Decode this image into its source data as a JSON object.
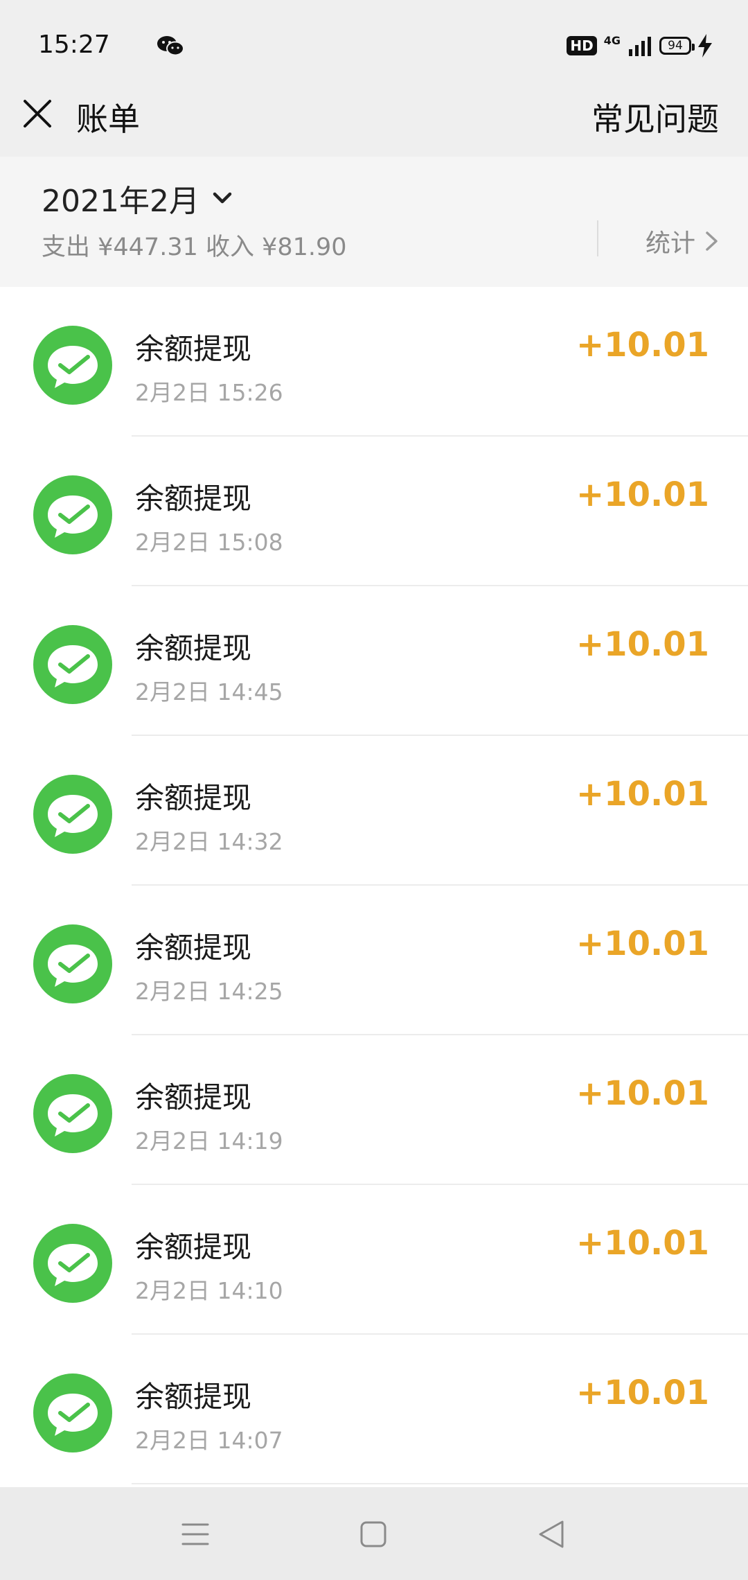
{
  "status_bar": {
    "time": "15:27",
    "notification_icon": "wechat-icon",
    "hd_badge": "HD",
    "network": "4G",
    "battery": "94"
  },
  "header": {
    "title": "账单",
    "faq": "常见问题",
    "close_icon": "close-icon"
  },
  "summary": {
    "month": "2021年2月",
    "totals": "支出 ¥447.31 收入 ¥81.90",
    "stats": "统计"
  },
  "transactions": [
    {
      "title": "余额提现",
      "time": "2月2日 15:26",
      "amount": "+10.01"
    },
    {
      "title": "余额提现",
      "time": "2月2日 15:08",
      "amount": "+10.01"
    },
    {
      "title": "余额提现",
      "time": "2月2日 14:45",
      "amount": "+10.01"
    },
    {
      "title": "余额提现",
      "time": "2月2日 14:32",
      "amount": "+10.01"
    },
    {
      "title": "余额提现",
      "time": "2月2日 14:25",
      "amount": "+10.01"
    },
    {
      "title": "余额提现",
      "time": "2月2日 14:19",
      "amount": "+10.01"
    },
    {
      "title": "余额提现",
      "time": "2月2日 14:10",
      "amount": "+10.01"
    },
    {
      "title": "余额提现",
      "time": "2月2日 14:07",
      "amount": "+10.01"
    }
  ],
  "colors": {
    "amount": "#eaa527",
    "wechat_green": "#4ac24a",
    "header_bg": "#efefef"
  }
}
